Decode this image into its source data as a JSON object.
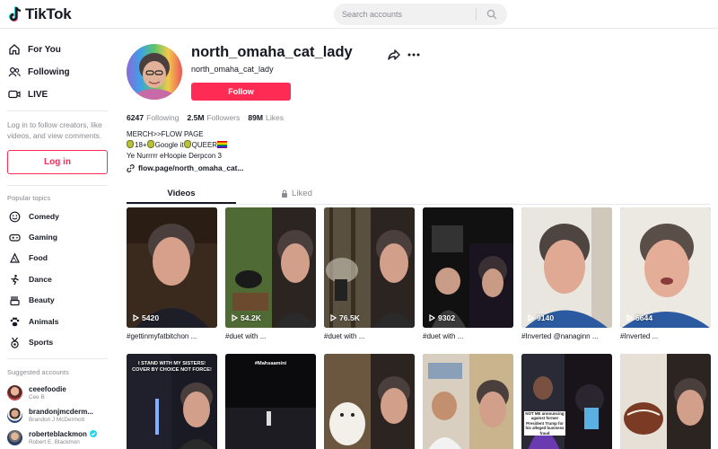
{
  "header": {
    "logo_text": "TikTok",
    "search_placeholder": "Search accounts"
  },
  "sidebar": {
    "nav": [
      {
        "label": "For You",
        "icon": "home-icon"
      },
      {
        "label": "Following",
        "icon": "users-icon"
      },
      {
        "label": "LIVE",
        "icon": "live-icon"
      }
    ],
    "login_note": "Log in to follow creators, like videos, and view comments.",
    "login_button": "Log in",
    "popular_title": "Popular topics",
    "topics": [
      {
        "label": "Comedy",
        "icon": "comedy-icon"
      },
      {
        "label": "Gaming",
        "icon": "gaming-icon"
      },
      {
        "label": "Food",
        "icon": "food-icon"
      },
      {
        "label": "Dance",
        "icon": "dance-icon"
      },
      {
        "label": "Beauty",
        "icon": "beauty-icon"
      },
      {
        "label": "Animals",
        "icon": "animals-icon"
      },
      {
        "label": "Sports",
        "icon": "sports-icon"
      }
    ],
    "suggested_title": "Suggested accounts",
    "suggested": [
      {
        "username": "ceeefoodie",
        "name": "Cee B",
        "verified": false
      },
      {
        "username": "brandonjmcderm...",
        "name": "Brandon J McDermott",
        "verified": false
      },
      {
        "username": "roberteblackmon",
        "name": "Robert E. Blackmon",
        "verified": true
      }
    ]
  },
  "profile": {
    "username": "north_omaha_cat_lady",
    "handle": "north_omaha_cat_lady",
    "follow_button": "Follow",
    "stats": {
      "following_count": "6247",
      "following_label": "Following",
      "followers_count": "2.5M",
      "followers_label": "Followers",
      "likes_count": "89M",
      "likes_label": "Likes"
    },
    "bio": {
      "line1": "MERCH>>FLOW PAGE",
      "line2_a": "18+",
      "line2_b": "Google it",
      "line2_c": "QUEER",
      "line3": "Ye Nurrrrr eHoopie Derpcon 3"
    },
    "link": "flow.page/north_omaha_cat..."
  },
  "tabs": {
    "videos": "Videos",
    "liked": "Liked"
  },
  "videos_row1": [
    {
      "views": "5420",
      "caption": "#gettinmyfatbitchon ..."
    },
    {
      "views": "54.2K",
      "caption": "#duet with ..."
    },
    {
      "views": "76.5K",
      "caption": "#duet with ..."
    },
    {
      "views": "9302",
      "caption": "#duet with ..."
    },
    {
      "views": "9140",
      "caption": "#Inverted @nanaginn ..."
    },
    {
      "views": "5644",
      "caption": "#Inverted ..."
    }
  ],
  "videos_row2_overlays": {
    "v1": "I STAND WITH MY SISTERS! COVER BY CHOICE NOT FORCE!",
    "v2": "#Mahsaamini",
    "v5": "NOT ME announcing against former President Trump for his alleged business fraud"
  },
  "colors": {
    "brand_red": "#fe2c55",
    "text_primary": "#161823",
    "text_secondary": "#8a8b91"
  }
}
